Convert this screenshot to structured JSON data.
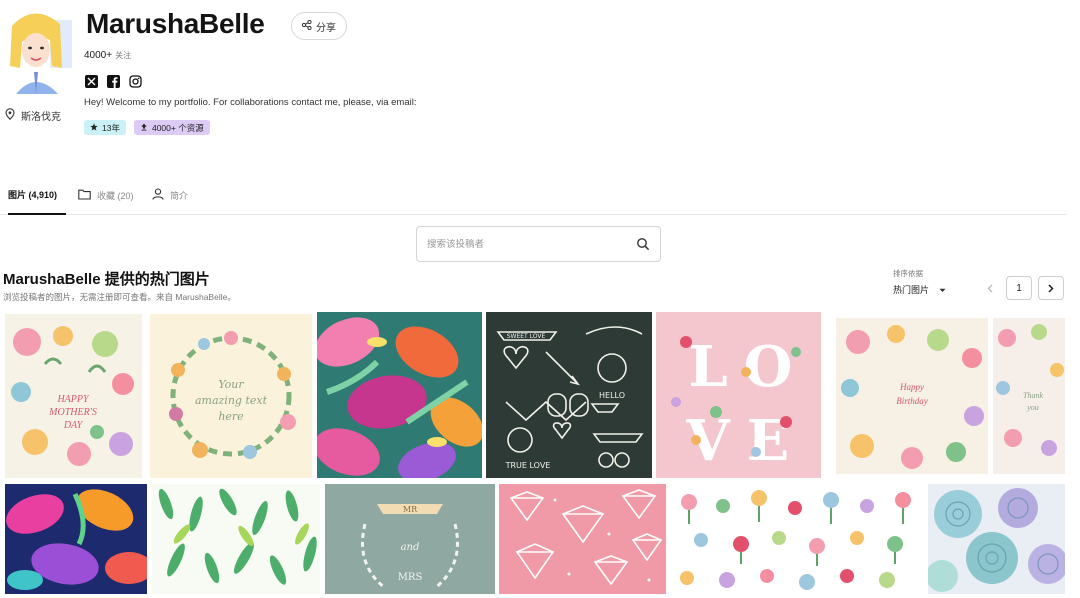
{
  "profile": {
    "name": "MarushaBelle",
    "followers_count": "4000+",
    "followers_unit": "关注",
    "location": "斯洛伐克",
    "bio": "Hey! Welcome to my portfolio. For collaborations contact me, please, via email:",
    "badge_years": "13年",
    "badge_assets": "4000+ 个资源",
    "share_label": "分享"
  },
  "socials": [
    "x-icon",
    "facebook-icon",
    "instagram-icon"
  ],
  "tabs": [
    {
      "label": "图片 (4,910)",
      "icon": "image"
    },
    {
      "label": "收藏 (20)",
      "icon": "folder-icon"
    },
    {
      "label": "简介",
      "icon": "user-icon"
    }
  ],
  "search": {
    "placeholder": "搜索该投稿者"
  },
  "section": {
    "title": "MarushaBelle 提供的热门图片",
    "subtitle": "浏览投稿者的图片，无需注册即可查看。来自 MarushaBelle。"
  },
  "sort": {
    "label": "排序依据",
    "value": "热门图片"
  },
  "pagination": {
    "current": "1"
  },
  "colors": {
    "badge_years_bg": "#c9f1f6",
    "badge_assets_bg": "#dccbf5",
    "chalkboard": "#2e3a35",
    "sage": "#8fa8a2",
    "pink": "#ef9aa6",
    "love_pink": "#f4c6cd",
    "cream": "#fbf2db"
  },
  "thumbnails": [
    {
      "name": "mothers-day-floral-card",
      "text": "HAPPY MOTHER'S DAY"
    },
    {
      "name": "floral-wreath-amazing-text",
      "text": "Your amazing text here"
    },
    {
      "name": "tropical-floral-pattern",
      "text": ""
    },
    {
      "name": "chalkboard-doodles",
      "text": "SWEET LOVE  HELLO  TRUE LOVE"
    },
    {
      "name": "love-floral-lettering",
      "text": "LOVE"
    },
    {
      "name": "birthday-floral-card",
      "text": "Happy Birthday"
    },
    {
      "name": "thank-you-floral-card",
      "text": "Thank you"
    },
    {
      "name": "colorful-floral-pattern",
      "text": ""
    },
    {
      "name": "green-leaves-pattern",
      "text": ""
    },
    {
      "name": "mr-and-mrs-wreath",
      "text": "MR AND MRS"
    },
    {
      "name": "diamonds-pattern",
      "text": ""
    },
    {
      "name": "hand-drawn-flowers-set",
      "text": ""
    },
    {
      "name": "watercolor-blue-roses",
      "text": ""
    }
  ]
}
